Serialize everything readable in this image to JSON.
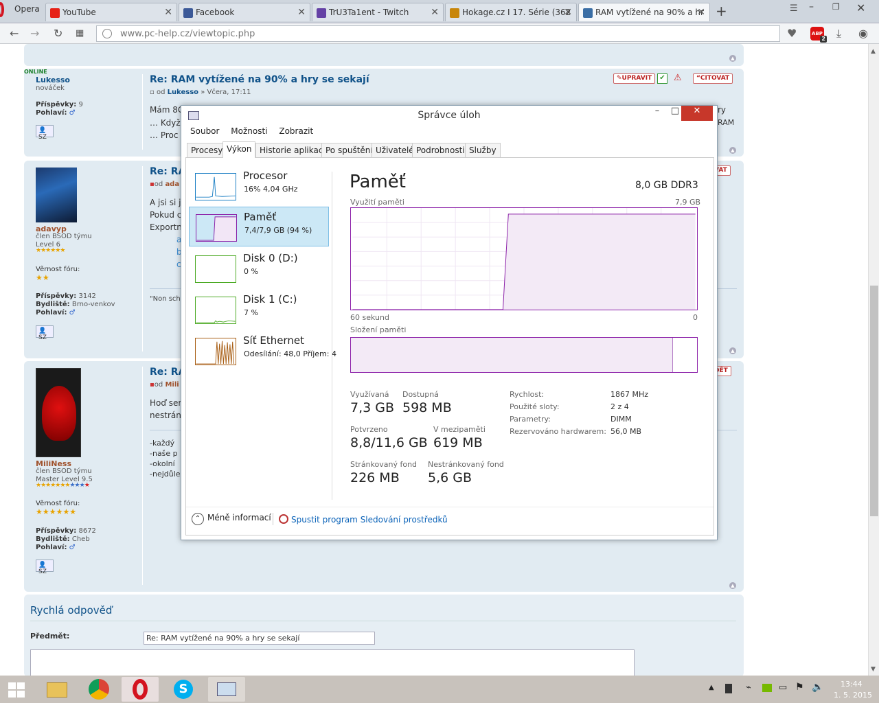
{
  "browser": {
    "opera_label": "Opera",
    "tabs": [
      {
        "label": "YouTube",
        "color": "#e62117"
      },
      {
        "label": "Facebook",
        "color": "#3b5998"
      },
      {
        "label": "TrU3Ta1ent - Twitch",
        "color": "#6441a5"
      },
      {
        "label": "Hokage.cz I 17. Série (362",
        "color": "#c8860a"
      },
      {
        "label": "RAM vytížené na 90% a hr",
        "color": "#3a6ea5"
      }
    ],
    "url": "www.pc-help.cz/viewtopic.php",
    "abp_badge": "2"
  },
  "posts": [
    {
      "online": "ONLINE",
      "user": "Lukesso",
      "rank": "nováček",
      "stats": [
        {
          "k": "Příspěvky:",
          "v": "9"
        },
        {
          "k": "Pohlaví:",
          "v": "♂"
        }
      ],
      "title": "Re: RAM vytížené na 90% a hry se sekají",
      "meta_od": "od",
      "meta_user": "Lukesso",
      "meta_time": "» Včera, 17:11",
      "body": [
        "Mám 8G",
        "… Když",
        "… Proc"
      ],
      "right_snip": [
        "ry",
        "RAM"
      ],
      "buttons": {
        "edit": "UPRAVIT",
        "quote": "CITOVAT"
      }
    },
    {
      "title_short": "Re: RA",
      "meta_od": "od",
      "meta_user": "ada",
      "user": "adavyp",
      "rank": "člen BSOD týmu",
      "level": "Level 6",
      "vernost": "Věrnost fóru:",
      "stats": [
        {
          "k": "Příspěvky:",
          "v": "3142"
        },
        {
          "k": "Bydliště:",
          "v": "Brno-venkov"
        },
        {
          "k": "Pohlaví:",
          "v": "♂"
        }
      ],
      "body": [
        "A jsi si j",
        "Pokud c",
        "Exportn"
      ],
      "links": [
        "a",
        "b",
        "c"
      ],
      "quote_snip": "\"Non sch",
      "button": "VAT"
    },
    {
      "title_short": "Re: RA",
      "meta_od": "od",
      "meta_user": "Mili",
      "user": "MiliNess",
      "rank": "člen BSOD týmu",
      "level": "Master Level 9.5",
      "vernost": "Věrnost fóru:",
      "stats": [
        {
          "k": "Příspěvky:",
          "v": "8672"
        },
        {
          "k": "Bydliště:",
          "v": "Cheb"
        },
        {
          "k": "Pohlaví:",
          "v": "♂"
        }
      ],
      "body": [
        "Hoď ser",
        "nestrán",
        "",
        "-každý",
        "-naše p",
        "-okolní",
        "-nejdůle"
      ],
      "button": "DĚT"
    }
  ],
  "pm_label": "SZ",
  "reply": {
    "heading": "Rychlá odpověď",
    "subject_label": "Předmět:",
    "subject_value": "Re: RAM vytížené na 90% a hry se sekají"
  },
  "taskmanager": {
    "title": "Správce úloh",
    "menu": [
      "Soubor",
      "Možnosti",
      "Zobrazit"
    ],
    "tabs": [
      "Procesy",
      "Výkon",
      "Historie aplikací",
      "Po spuštění",
      "Uživatelé",
      "Podrobnosti",
      "Služby"
    ],
    "resources": [
      {
        "name": "Procesor",
        "sub": "16% 4,04 GHz",
        "color": "#1b7fc4"
      },
      {
        "name": "Paměť",
        "sub": "7,4/7,9 GB (94 %)",
        "color": "#8b1fa8"
      },
      {
        "name": "Disk 0 (D:)",
        "sub": "0 %",
        "color": "#4caa24"
      },
      {
        "name": "Disk 1 (C:)",
        "sub": "7 %",
        "color": "#4caa24"
      },
      {
        "name": "Síť Ethernet",
        "sub": "Odesílání: 48,0 Příjem: 4",
        "color": "#a85e14"
      }
    ],
    "heading": "Paměť",
    "heading_right": "8,0 GB DDR3",
    "usage_label": "Využití paměti",
    "usage_max": "7,9 GB",
    "axis_left": "60 sekund",
    "axis_right": "0",
    "composition_label": "Složení paměti",
    "usage_fraction_now": 0.94,
    "composition_used_fraction": 0.93,
    "stats": [
      {
        "label": "Využívaná",
        "value": "7,3 GB"
      },
      {
        "label": "Dostupná",
        "value": "598 MB"
      },
      {
        "label": "Potvrzeno",
        "value": "8,8/11,6 GB"
      },
      {
        "label": "V mezipaměti",
        "value": "619 MB"
      },
      {
        "label": "Stránkovaný fond",
        "value": "226 MB"
      },
      {
        "label": "Nestránkovaný fond",
        "value": "5,6 GB"
      }
    ],
    "details": [
      {
        "k": "Rychlost:",
        "v": "1867 MHz"
      },
      {
        "k": "Použité sloty:",
        "v": "2 z 4"
      },
      {
        "k": "Parametry:",
        "v": "DIMM"
      },
      {
        "k": "Rezervováno hardwarem:",
        "v": "56,0 MB"
      }
    ],
    "less_info": "Méně informací",
    "resmon": "Spustit program Sledování prostředků"
  },
  "taskbar": {
    "time": "13:44",
    "date": "1. 5. 2015"
  }
}
